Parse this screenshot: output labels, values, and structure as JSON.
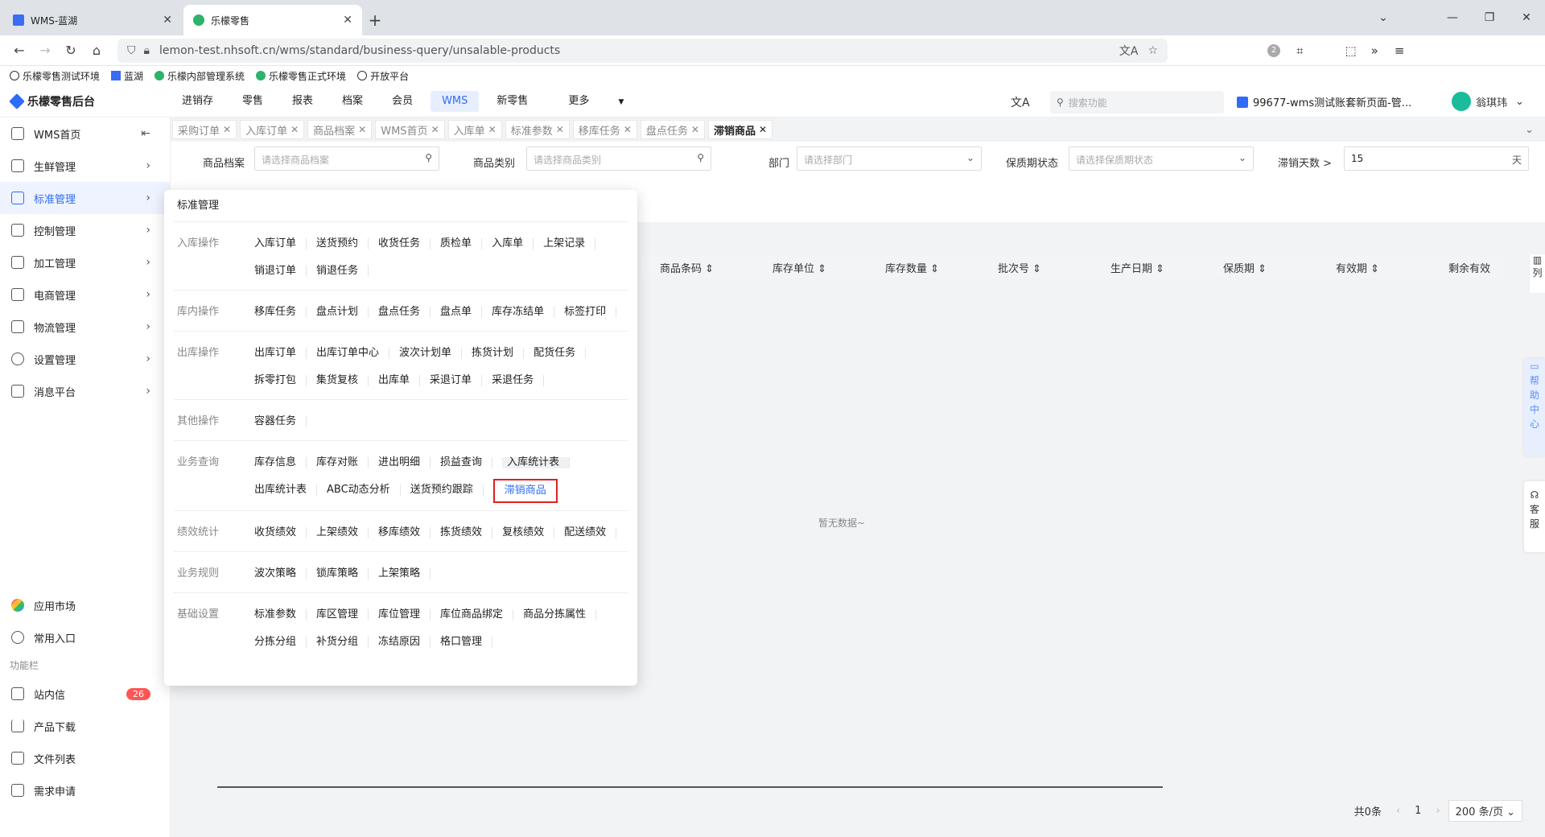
{
  "browser": {
    "tabs": [
      {
        "title": "WMS-蓝湖",
        "close": "✕"
      },
      {
        "title": "乐檬零售",
        "close": "✕"
      }
    ],
    "url": "lemon-test.nhsoft.cn/wms/standard/business-query/unsalable-products",
    "extension_badge": "2",
    "bookmarks": [
      "乐檬零售测试环境",
      "蓝湖",
      "乐檬内部管理系统",
      "乐檬零售正式环境",
      "开放平台"
    ]
  },
  "app": {
    "logo": "乐檬零售后台",
    "topnav": [
      "进销存",
      "零售",
      "报表",
      "档案",
      "会员",
      "WMS",
      "新零售",
      "更多"
    ],
    "topnav_active": "WMS",
    "search_placeholder": "搜索功能",
    "account": "99677-wms测试账套新页面-管...",
    "user": "翁琪玮"
  },
  "sidebar": {
    "items": [
      "WMS首页",
      "生鲜管理",
      "标准管理",
      "控制管理",
      "加工管理",
      "电商管理",
      "物流管理",
      "设置管理",
      "消息平台"
    ],
    "active": "标准管理",
    "bottom": [
      "应用市场",
      "常用入口"
    ],
    "group_label": "功能栏",
    "tools": [
      {
        "label": "站内信",
        "badge": "26"
      },
      {
        "label": "产品下载"
      },
      {
        "label": "文件列表"
      },
      {
        "label": "需求申请"
      }
    ]
  },
  "page_tabs": [
    "采购订单",
    "入库订单",
    "商品档案",
    "WMS首页",
    "入库单",
    "标准参数",
    "移库任务",
    "盘点任务",
    "滞销商品"
  ],
  "active_page_tab": "滞销商品",
  "filters": {
    "goods_label": "商品档案",
    "goods_placeholder": "请选择商品档案",
    "category_label": "商品类别",
    "category_placeholder": "请选择商品类别",
    "dept_label": "部门",
    "dept_placeholder": "请选择部门",
    "shelf_label": "保质期状态",
    "shelf_placeholder": "请选择保质期状态",
    "days_label": "滞销天数 >",
    "days_value": "15",
    "days_unit": "天"
  },
  "grid": {
    "columns": [
      "商品条码",
      "库存单位",
      "库存数量",
      "批次号",
      "生产日期",
      "保质期",
      "有效期",
      "剩余有效"
    ],
    "empty": "暂无数据~",
    "col_btn": "列"
  },
  "pager": {
    "total": "共0条",
    "page": "1",
    "size": "200 条/页"
  },
  "side_buttons": {
    "help": [
      "帮",
      "助",
      "中",
      "心"
    ],
    "service": [
      "客",
      "服"
    ]
  },
  "panel": {
    "title": "标准管理",
    "sections": [
      {
        "label": "入库操作",
        "links": [
          "入库订单",
          "送货预约",
          "收货任务",
          "质检单",
          "入库单",
          "上架记录",
          "销退订单",
          "销退任务"
        ]
      },
      {
        "label": "库内操作",
        "links": [
          "移库任务",
          "盘点计划",
          "盘点任务",
          "盘点单",
          "库存冻结单",
          "标签打印"
        ]
      },
      {
        "label": "出库操作",
        "links": [
          "出库订单",
          "出库订单中心",
          "波次计划单",
          "拣货计划",
          "配货任务",
          "拆零打包",
          "集货复核",
          "出库单",
          "采退订单",
          "采退任务"
        ]
      },
      {
        "label": "其他操作",
        "links": [
          "容器任务"
        ]
      },
      {
        "label": "业务查询",
        "links": [
          "库存信息",
          "库存对账",
          "进出明细",
          "损益查询",
          "入库统计表",
          "出库统计表",
          "ABC动态分析",
          "送货预约跟踪",
          "滞销商品"
        ]
      },
      {
        "label": "绩效统计",
        "links": [
          "收货绩效",
          "上架绩效",
          "移库绩效",
          "拣货绩效",
          "复核绩效",
          "配送绩效"
        ]
      },
      {
        "label": "业务规则",
        "links": [
          "波次策略",
          "锁库策略",
          "上架策略"
        ]
      },
      {
        "label": "基础设置",
        "links": [
          "标准参数",
          "库区管理",
          "库位管理",
          "库位商品绑定",
          "商品分拣属性",
          "分拣分组",
          "补货分组",
          "冻结原因",
          "格口管理"
        ]
      }
    ],
    "highlight": "滞销商品",
    "hover": "入库统计表"
  }
}
